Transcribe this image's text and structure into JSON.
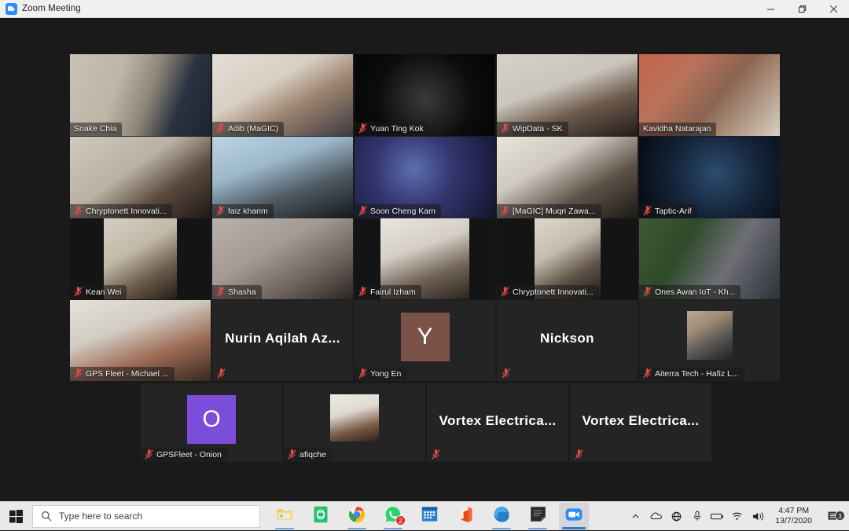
{
  "window": {
    "title": "Zoom Meeting",
    "logo_icon": "zoom-logo-icon",
    "controls": {
      "minimize_label": "Minimize",
      "restore_label": "Restore Down",
      "close_label": "Close"
    }
  },
  "meeting": {
    "layout": "gallery-view",
    "speaking_border_color": "#d7e02a",
    "muted_icon_color": "#e04a4a",
    "tile_background": "#242424",
    "participants": [
      {
        "name": "Snake Chia",
        "muted": false,
        "speaking": false,
        "display": "video",
        "row": 1,
        "col": 1
      },
      {
        "name": "Adib (MaGIC)",
        "muted": true,
        "speaking": false,
        "display": "video",
        "row": 1,
        "col": 2
      },
      {
        "name": "Yuan Ting Kok",
        "muted": true,
        "speaking": false,
        "display": "video",
        "row": 1,
        "col": 3
      },
      {
        "name": "WipData - SK",
        "muted": true,
        "speaking": false,
        "display": "video",
        "row": 1,
        "col": 4
      },
      {
        "name": "Kavidha Natarajan",
        "muted": false,
        "speaking": true,
        "display": "video",
        "row": 1,
        "col": 5
      },
      {
        "name": "Chryptonett Innovati...",
        "muted": true,
        "speaking": false,
        "display": "video",
        "row": 2,
        "col": 1
      },
      {
        "name": "faiz kharim",
        "muted": true,
        "speaking": false,
        "display": "video",
        "row": 2,
        "col": 2
      },
      {
        "name": "Soon Cheng Kam",
        "muted": true,
        "speaking": false,
        "display": "video",
        "row": 2,
        "col": 3
      },
      {
        "name": "[MaGIC] Muqri Zawa...",
        "muted": true,
        "speaking": false,
        "display": "video",
        "row": 2,
        "col": 4
      },
      {
        "name": "Taptic-Arif",
        "muted": true,
        "speaking": false,
        "display": "video",
        "row": 2,
        "col": 5
      },
      {
        "name": "Kean Wei",
        "muted": true,
        "speaking": false,
        "display": "video-narrow",
        "row": 3,
        "col": 1
      },
      {
        "name": "Shasha",
        "muted": true,
        "speaking": false,
        "display": "video",
        "row": 3,
        "col": 2
      },
      {
        "name": "Fairul Izham",
        "muted": true,
        "speaking": false,
        "display": "video-narrow",
        "row": 3,
        "col": 3
      },
      {
        "name": "Chryptonett Innovati...",
        "muted": true,
        "speaking": false,
        "display": "video-narrow",
        "row": 3,
        "col": 4
      },
      {
        "name": "Ones Awan IoT - Kh...",
        "muted": true,
        "speaking": false,
        "display": "video",
        "row": 3,
        "col": 5
      },
      {
        "name": "GPS Fleet - Michael ...",
        "muted": true,
        "speaking": false,
        "display": "video",
        "row": 4,
        "col": 1
      },
      {
        "name": "",
        "muted": true,
        "speaking": false,
        "display": "name-only",
        "big_name": "Nurin Aqilah Az...",
        "row": 4,
        "col": 2
      },
      {
        "name": "Yong En",
        "muted": true,
        "speaking": false,
        "display": "initial",
        "initial": "Y",
        "avatar_color": "#7a5248",
        "row": 4,
        "col": 3
      },
      {
        "name": "",
        "muted": true,
        "speaking": false,
        "display": "name-only",
        "big_name": "Nickson",
        "row": 4,
        "col": 4
      },
      {
        "name": "Aiterra Tech - Hafiz L...",
        "muted": true,
        "speaking": false,
        "display": "photo",
        "row": 4,
        "col": 5
      },
      {
        "name": "GPSFleet - Onion",
        "muted": true,
        "speaking": false,
        "display": "initial",
        "initial": "O",
        "avatar_color": "#7c4ddb",
        "row": 5,
        "col": 1
      },
      {
        "name": "afiqche",
        "muted": true,
        "speaking": false,
        "display": "photo",
        "row": 5,
        "col": 2
      },
      {
        "name": "",
        "muted": true,
        "speaking": false,
        "display": "name-only",
        "big_name": "Vortex  Electrica...",
        "row": 5,
        "col": 3
      },
      {
        "name": "",
        "muted": true,
        "speaking": false,
        "display": "name-only",
        "big_name": "Vortex  Electrica...",
        "row": 5,
        "col": 4
      }
    ]
  },
  "taskbar": {
    "start_label": "Start",
    "search_placeholder": "Type here to search",
    "search_icon": "search-icon",
    "apps": [
      {
        "name": "file-explorer",
        "label": "File Explorer",
        "running": true,
        "active": false,
        "badge": ""
      },
      {
        "name": "evernote",
        "label": "Evernote",
        "running": false,
        "active": false,
        "badge": ""
      },
      {
        "name": "chrome",
        "label": "Google Chrome",
        "running": true,
        "active": false,
        "badge": ""
      },
      {
        "name": "whatsapp",
        "label": "WhatsApp",
        "running": true,
        "active": false,
        "badge": "2"
      },
      {
        "name": "calendar",
        "label": "Calendar",
        "running": false,
        "active": false,
        "badge": ""
      },
      {
        "name": "office",
        "label": "Office",
        "running": false,
        "active": false,
        "badge": ""
      },
      {
        "name": "edge",
        "label": "Microsoft Edge",
        "running": true,
        "active": false,
        "badge": ""
      },
      {
        "name": "sticky-notes",
        "label": "Sticky Notes",
        "running": true,
        "active": false,
        "badge": ""
      },
      {
        "name": "zoom",
        "label": "Zoom",
        "running": true,
        "active": true,
        "badge": ""
      }
    ],
    "tray": {
      "show_hidden_icons": "chevron-up-icon",
      "onedrive_icon": "cloud-icon",
      "network_icon": "globe-icon",
      "microphone_icon": "microphone-icon",
      "battery_icon": "battery-icon",
      "wifi_icon": "wifi-icon",
      "volume_icon": "speaker-icon",
      "time": "4:47 PM",
      "date": "13/7/2020",
      "notification_icon": "action-center-icon",
      "notification_count": "3"
    }
  }
}
